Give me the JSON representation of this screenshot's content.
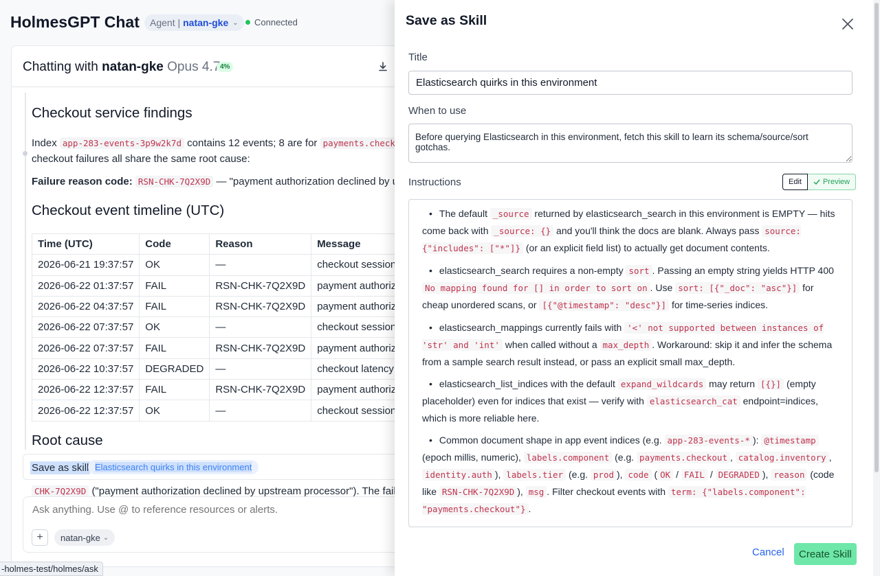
{
  "app": {
    "title": "HolmesGPT Chat"
  },
  "agent_selector": {
    "prefix": "Agent |",
    "name": "natan-gke"
  },
  "connection": {
    "status": "Connected",
    "color": "#22c55e"
  },
  "chat": {
    "heading_prefix": "Chatting with",
    "agent": "natan-gke",
    "model": "Opus 4.7",
    "context_badge": "4%",
    "sections": {
      "findings_title": "Checkout service findings",
      "index_intro": "Index",
      "index_name": "app-283-events-3p9w2k7d",
      "index_mid": "contains 12 events; 8 are for",
      "index_component": "payments.checkout",
      "index_tail": "checkout failures all share the same root cause:",
      "failure_label": "Failure reason code:",
      "failure_code": "RSN-CHK-7Q2X9D",
      "failure_text": "— \"payment authorization declined by upstrea",
      "timeline_title": "Checkout event timeline (UTC)",
      "root_cause_title": "Root cause",
      "cut_code": "CHK-7Q2X9D",
      "cut_text": "(\"payment authorization declined by upstream processor\"). The failures"
    },
    "table": {
      "headers": [
        "Time (UTC)",
        "Code",
        "Reason",
        "Message"
      ],
      "rows": [
        [
          "2026-06-21 19:37:57",
          "OK",
          "—",
          "checkout session compl"
        ],
        [
          "2026-06-22 01:37:57",
          "FAIL",
          "RSN-CHK-7Q2X9D",
          "payment authorization d"
        ],
        [
          "2026-06-22 04:37:57",
          "FAIL",
          "RSN-CHK-7Q2X9D",
          "payment authorization d"
        ],
        [
          "2026-06-22 07:37:57",
          "OK",
          "—",
          "checkout session compl"
        ],
        [
          "2026-06-22 07:37:57",
          "FAIL",
          "RSN-CHK-7Q2X9D",
          "payment authorization d"
        ],
        [
          "2026-06-22 10:37:57",
          "DEGRADED",
          "—",
          "checkout latency above t"
        ],
        [
          "2026-06-22 12:37:57",
          "FAIL",
          "RSN-CHK-7Q2X9D",
          "payment authorization d"
        ],
        [
          "2026-06-22 12:37:57",
          "OK",
          "—",
          "checkout session compl"
        ]
      ]
    },
    "save_skill": {
      "label": "Save as skill",
      "chip": "Elasticsearch quirks in this environment"
    },
    "composer": {
      "placeholder": "Ask anything. Use @ to reference resources or alerts.",
      "agent_chip": "natan-gke"
    }
  },
  "status_bar": {
    "url": "-holmes-test/holmes/ask"
  },
  "drawer": {
    "title": "Save as Skill",
    "title_label": "Title",
    "title_value": "Elasticsearch quirks in this environment",
    "when_label": "When to use",
    "when_value": "Before querying Elasticsearch in this environment, fetch this skill to learn its schema/source/sort gotchas.",
    "instructions_label": "Instructions",
    "edit_label": "Edit",
    "preview_label": "Preview",
    "cancel_label": "Cancel",
    "create_label": "Create Skill",
    "accent": "#6ee7a8",
    "instructions": [
      [
        {
          "t": "The default "
        },
        {
          "c": "_source"
        },
        {
          "t": " returned by elasticsearch_search in this environment is EMPTY — hits come back with "
        },
        {
          "c": "_source: {}"
        },
        {
          "t": " and you'll think the docs are blank. Always pass "
        },
        {
          "c": "source: {\"includes\": [\"*\"]}"
        },
        {
          "t": " (or an explicit field list) to actually get document contents."
        }
      ],
      [
        {
          "t": "elasticsearch_search requires a non-empty "
        },
        {
          "c": "sort"
        },
        {
          "t": ". Passing an empty string yields HTTP 400 "
        },
        {
          "c": "No mapping found for [] in order to sort on"
        },
        {
          "t": ". Use "
        },
        {
          "c": "sort: [{\"_doc\": \"asc\"}]"
        },
        {
          "t": " for cheap unordered scans, or "
        },
        {
          "c": "[{\"@timestamp\": \"desc\"}]"
        },
        {
          "t": " for time-series indices."
        }
      ],
      [
        {
          "t": "elasticsearch_mappings currently fails with "
        },
        {
          "c": "'<' not supported between instances of 'str' and 'int'"
        },
        {
          "t": " when called without a "
        },
        {
          "c": "max_depth"
        },
        {
          "t": ". Workaround: skip it and infer the schema from a sample search result instead, or pass an explicit small max_depth."
        }
      ],
      [
        {
          "t": "elasticsearch_list_indices with the default "
        },
        {
          "c": "expand_wildcards"
        },
        {
          "t": " may return "
        },
        {
          "c": "[{}]"
        },
        {
          "t": " (empty placeholder) even for indices that exist — verify with "
        },
        {
          "c": "elasticsearch_cat"
        },
        {
          "t": " endpoint=indices, which is more reliable here."
        }
      ],
      [
        {
          "t": "Common document shape in app event indices (e.g. "
        },
        {
          "c": "app-283-events-*"
        },
        {
          "t": "): "
        },
        {
          "c": "@timestamp"
        },
        {
          "t": " (epoch millis, numeric), "
        },
        {
          "c": "labels.component"
        },
        {
          "t": " (e.g. "
        },
        {
          "c": "payments.checkout"
        },
        {
          "t": ", "
        },
        {
          "c": "catalog.inventory"
        },
        {
          "t": ", "
        },
        {
          "c": "identity.auth"
        },
        {
          "t": "), "
        },
        {
          "c": "labels.tier"
        },
        {
          "t": " (e.g. "
        },
        {
          "c": "prod"
        },
        {
          "t": "), "
        },
        {
          "c": "code"
        },
        {
          "t": " ("
        },
        {
          "c": "OK"
        },
        {
          "t": " / "
        },
        {
          "c": "FAIL"
        },
        {
          "t": " / "
        },
        {
          "c": "DEGRADED"
        },
        {
          "t": "), "
        },
        {
          "c": "reason"
        },
        {
          "t": " (code like "
        },
        {
          "c": "RSN-CHK-7Q2X9D"
        },
        {
          "t": "), "
        },
        {
          "c": "msg"
        },
        {
          "t": ". Filter checkout events with "
        },
        {
          "c": "term: {\"labels.component\": \"payments.checkout\"}"
        },
        {
          "t": "."
        }
      ]
    ]
  }
}
